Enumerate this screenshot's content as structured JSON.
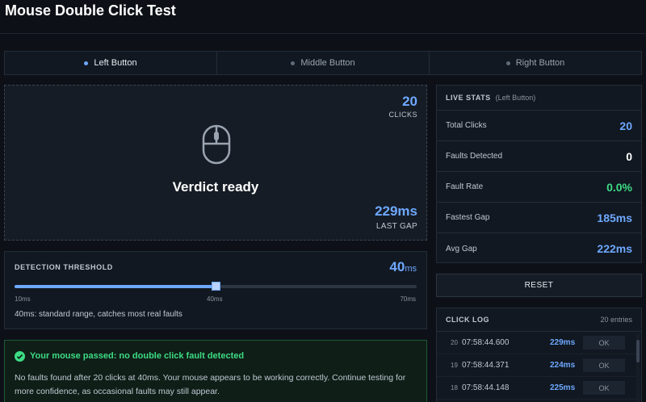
{
  "header": {
    "title": "Mouse Double Click Test"
  },
  "tabs": [
    {
      "label": "Left Button",
      "active": true
    },
    {
      "label": "Middle Button",
      "active": false
    },
    {
      "label": "Right Button",
      "active": false
    }
  ],
  "click_area": {
    "count": "20",
    "count_label": "CLICKS",
    "verdict": "Verdict ready",
    "last_gap": "229ms",
    "last_gap_label": "LAST GAP",
    "icon": "mouse-icon"
  },
  "threshold": {
    "label": "DETECTION THRESHOLD",
    "value": "40",
    "unit": "ms",
    "min_label": "10ms",
    "mid_label": "40ms",
    "max_label": "70ms",
    "fill_fraction": 0.5,
    "description": "40ms: standard range, catches most real faults"
  },
  "result": {
    "headline": "Your mouse passed: no double click fault detected",
    "body": "No faults found after 20 clicks at 40ms. Your mouse appears to be working correctly. Continue testing for more confidence, as occasional faults may still appear.",
    "icon": "check-circle-icon"
  },
  "stats": {
    "title": "LIVE STATS",
    "subtitle": "(Left Button)",
    "rows": [
      {
        "label": "Total Clicks",
        "value": "20",
        "color": "#6ea8ff"
      },
      {
        "label": "Faults Detected",
        "value": "0",
        "color": "#ffffff"
      },
      {
        "label": "Fault Rate",
        "value": "0.0%",
        "color": "#3ddc84"
      },
      {
        "label": "Fastest Gap",
        "value": "185ms",
        "color": "#6ea8ff"
      },
      {
        "label": "Avg Gap",
        "value": "222ms",
        "color": "#6ea8ff"
      }
    ]
  },
  "reset": {
    "label": "RESET"
  },
  "log": {
    "title": "CLICK LOG",
    "count": "20 entries",
    "entries": [
      {
        "index": "20",
        "time": "07:58:44.600",
        "gap": "229ms",
        "status": "OK"
      },
      {
        "index": "19",
        "time": "07:58:44.371",
        "gap": "224ms",
        "status": "OK"
      },
      {
        "index": "18",
        "time": "07:58:44.148",
        "gap": "225ms",
        "status": "OK"
      }
    ]
  },
  "colors": {
    "accent": "#6ea8ff",
    "success": "#3ddc84",
    "background": "#0d1117"
  }
}
